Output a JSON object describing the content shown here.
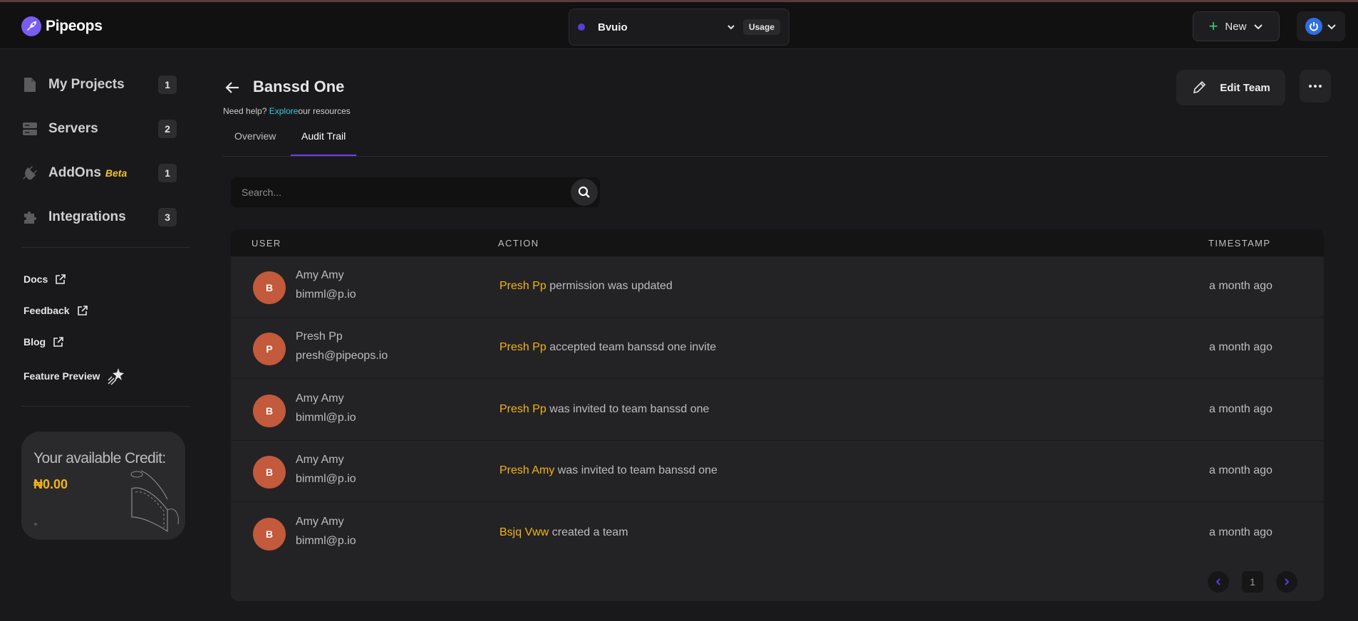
{
  "app": {
    "name": "Pipeops"
  },
  "workspace": {
    "name": "Bvuio",
    "usage_label": "Usage"
  },
  "header": {
    "new_label": "New"
  },
  "sidebar": {
    "items": [
      {
        "label": "My Projects",
        "count": "1",
        "icon": "file-icon"
      },
      {
        "label": "Servers",
        "count": "2",
        "icon": "server-icon"
      },
      {
        "label": "AddOns",
        "beta": "Beta",
        "count": "1",
        "icon": "plug-icon"
      },
      {
        "label": "Integrations",
        "count": "3",
        "icon": "puzzle-icon"
      }
    ],
    "links": [
      {
        "label": "Docs",
        "icon": "external-link-icon"
      },
      {
        "label": "Feedback",
        "icon": "external-link-icon"
      },
      {
        "label": "Blog",
        "icon": "external-link-icon"
      },
      {
        "label": "Feature Preview",
        "icon": "sparkle-icon"
      }
    ],
    "credit": {
      "title": "Your available Credit:",
      "value": "₦0.00"
    }
  },
  "page": {
    "title": "Banssd One",
    "help_prefix": "Need help? ",
    "help_link": "Explore",
    "help_suffix": "our resources",
    "edit_label": "Edit Team",
    "tabs": [
      {
        "label": "Overview",
        "active": false
      },
      {
        "label": "Audit Trail",
        "active": true
      }
    ]
  },
  "search": {
    "placeholder": "Search..."
  },
  "audit": {
    "headers": {
      "user": "USER",
      "action": "ACTION",
      "timestamp": "TIMESTAMP"
    },
    "rows": [
      {
        "initial": "B",
        "name": "Amy Amy",
        "email": "bimml@p.io",
        "actor": "Presh Pp",
        "action": " permission was updated",
        "time": "a month ago"
      },
      {
        "initial": "P",
        "name": "Presh Pp",
        "email": "presh@pipeops.io",
        "actor": "Presh Pp",
        "action": " accepted team banssd one invite",
        "time": "a month ago"
      },
      {
        "initial": "B",
        "name": "Amy Amy",
        "email": "bimml@p.io",
        "actor": "Presh Pp",
        "action": " was invited to team banssd one",
        "time": "a month ago"
      },
      {
        "initial": "B",
        "name": "Amy Amy",
        "email": "bimml@p.io",
        "actor": "Presh Amy",
        "action": " was invited to team banssd one",
        "time": "a month ago"
      },
      {
        "initial": "B",
        "name": "Amy Amy",
        "email": "bimml@p.io",
        "actor": "Bsjq Vww",
        "action": " created a team",
        "time": "a month ago"
      }
    ],
    "page": "1"
  },
  "colors": {
    "accent": "#6d3ff0",
    "highlight": "#f2b418",
    "avatar": "#c25a3b",
    "link": "#3ec7d8"
  }
}
